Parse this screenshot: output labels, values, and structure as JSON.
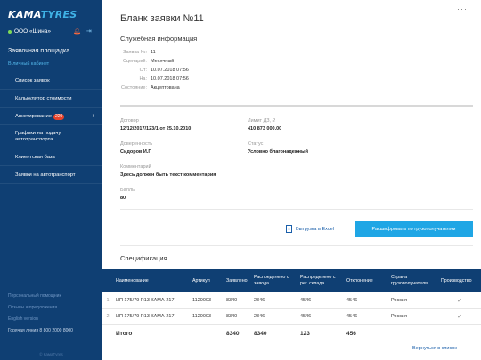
{
  "sidebar": {
    "logo_part1": "KAMA",
    "logo_part2": "TYRES",
    "company": "ООО «Шина»",
    "section_title": "Заявочная площадка",
    "section_sub": "В личный кабинет",
    "items": [
      {
        "label": "Список заявок"
      },
      {
        "label": "Калькулятор стоимости"
      },
      {
        "label": "Анкетирование",
        "badge": "220"
      },
      {
        "label": "Графики на подачу автотранспорта"
      },
      {
        "label": "Клиентская база"
      },
      {
        "label": "Заявки на автотранспорт"
      }
    ],
    "footer_links": [
      "Персональный помощник",
      "Отзывы и предложения",
      "English version"
    ],
    "hotline": "Горячая линия 8 800 2000 8000",
    "copyright": "© КамаТyres"
  },
  "page": {
    "title": "Бланк заявки №11",
    "service_title": "Служебная информация",
    "service": [
      {
        "k": "Заявка №:",
        "v": "11"
      },
      {
        "k": "Сценарий:",
        "v": "Месячный"
      },
      {
        "k": "От:",
        "v": "10.07.2018 07:56"
      },
      {
        "k": "На:",
        "v": "10.07.2018 07:56"
      },
      {
        "k": "Состояние:",
        "v": "Акцептована"
      }
    ],
    "contract_label": "Договор",
    "contract_value": "12/12/2017/123/1 от 25.10.2010",
    "limit_label": "Лимит ДЗ, ₽",
    "limit_value": "410 873 000.00",
    "attorney_label": "Доверенность",
    "attorney_value": "Сидоров И.Г.",
    "status_label": "Статус",
    "status_value": "Условно благонадежный",
    "comment_label": "Комментарий",
    "comment_value": "Здесь должен быть текст комментария",
    "points_label": "Баллы",
    "points_value": "80",
    "excel_label": "Выгрузка в Excel",
    "decode_button": "Расшифровать по грузополучателям",
    "spec_title": "Спецификация",
    "back_link": "Вернуться в список"
  },
  "table": {
    "headers": [
      "Наименование",
      "Артикул",
      "Заявлено",
      "Распределено с завода",
      "Распределено с рег. склада",
      "Отклонение",
      "Страна грузополучателя",
      "Производство"
    ],
    "rows": [
      {
        "n": "1",
        "name": "ИП 175/79 R13 КАМА-217",
        "article": "1120003",
        "declared": "8340",
        "factory": "2346",
        "warehouse": "4546",
        "deviation": "4546",
        "country": "Россия"
      },
      {
        "n": "2",
        "name": "ИП 175/79 R13 КАМА-217",
        "article": "1120003",
        "declared": "8340",
        "factory": "2346",
        "warehouse": "4546",
        "deviation": "4546",
        "country": "Россия"
      }
    ],
    "total": {
      "label": "Итого",
      "declared": "8340",
      "factory": "8340",
      "warehouse": "123",
      "deviation": "456"
    }
  }
}
